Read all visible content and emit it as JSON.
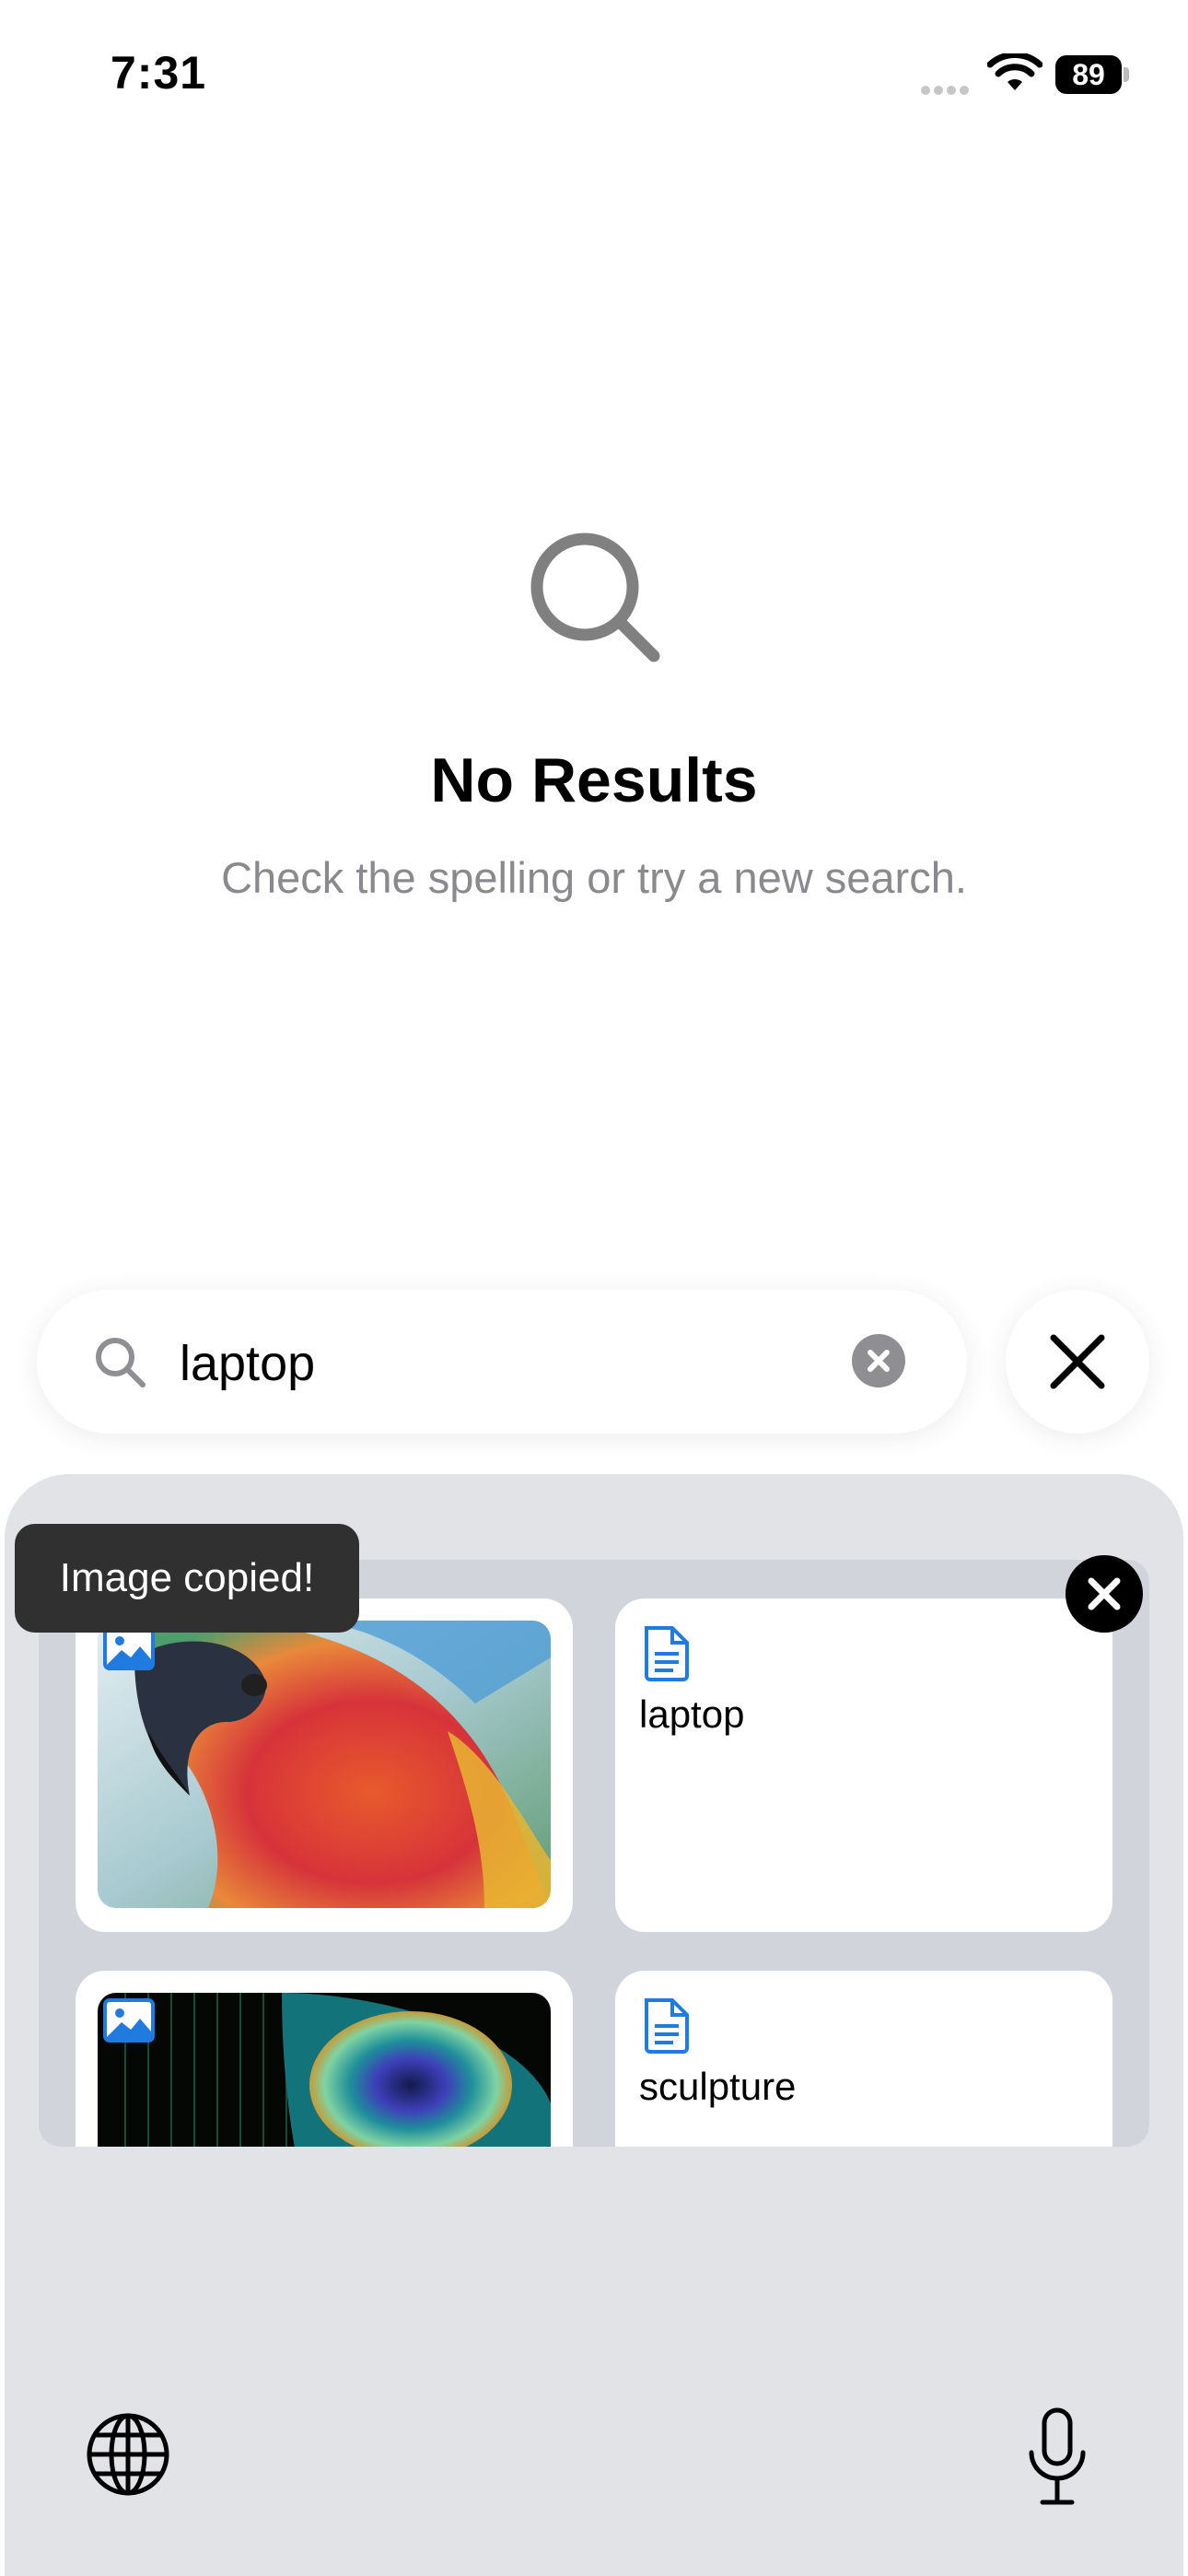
{
  "status_bar": {
    "time": "7:31",
    "battery": "89"
  },
  "empty_state": {
    "icon": "magnifying-glass-icon",
    "title": "No Results",
    "subtitle": "Check the spelling or try a new search."
  },
  "search": {
    "value": "laptop",
    "clear_icon": "clear-icon",
    "cancel_icon": "close-icon"
  },
  "toast": {
    "message": "Image copied!"
  },
  "results": [
    {
      "type": "image",
      "icon": "image-icon",
      "description": "parrot"
    },
    {
      "type": "text",
      "icon": "document-icon",
      "label": "laptop"
    },
    {
      "type": "image",
      "icon": "image-icon",
      "description": "peacock feather"
    },
    {
      "type": "text",
      "icon": "document-icon",
      "label": "sculpture"
    }
  ],
  "keyboard": {
    "left_icon": "globe-icon",
    "right_icon": "microphone-icon"
  },
  "colors": {
    "accent": "#1f7be0",
    "panel": "#e2e3e7",
    "toast": "#303030"
  }
}
